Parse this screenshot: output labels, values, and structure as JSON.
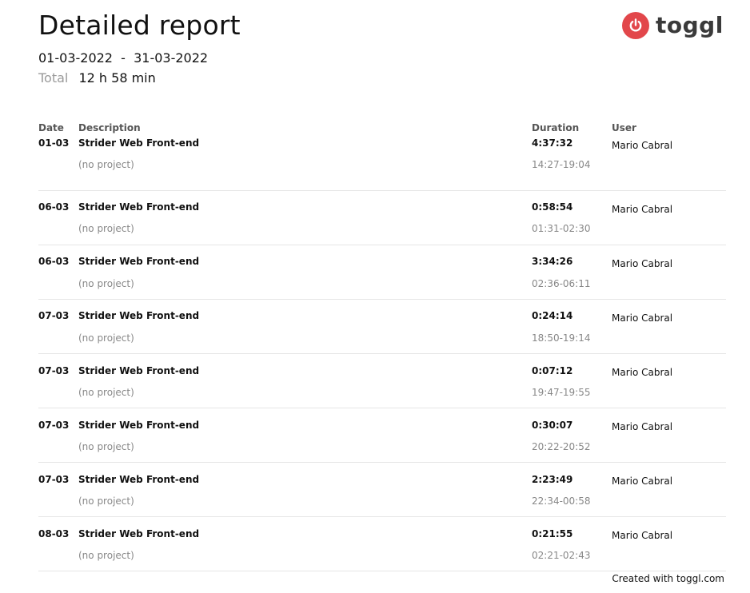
{
  "report": {
    "title": "Detailed report",
    "date_range": "01-03-2022  -  31-03-2022",
    "total_label": "Total",
    "total_value": "12 h 58 min"
  },
  "logo": {
    "wordmark": "toggl",
    "icon": "power-icon",
    "color": "#e2474b"
  },
  "table": {
    "headers": {
      "date": "Date",
      "description": "Description",
      "duration": "Duration",
      "user": "User"
    },
    "rows": [
      {
        "date": "01-03",
        "description": "Strider Web Front-end",
        "project": "(no project)",
        "duration": "4:37:32",
        "time_range": "14:27-19:04",
        "user": "Mario Cabral"
      },
      {
        "date": "06-03",
        "description": "Strider Web Front-end",
        "project": "(no project)",
        "duration": "0:58:54",
        "time_range": "01:31-02:30",
        "user": "Mario Cabral"
      },
      {
        "date": "06-03",
        "description": "Strider Web Front-end",
        "project": "(no project)",
        "duration": "3:34:26",
        "time_range": "02:36-06:11",
        "user": "Mario Cabral"
      },
      {
        "date": "07-03",
        "description": "Strider Web Front-end",
        "project": "(no project)",
        "duration": "0:24:14",
        "time_range": "18:50-19:14",
        "user": "Mario Cabral"
      },
      {
        "date": "07-03",
        "description": "Strider Web Front-end",
        "project": "(no project)",
        "duration": "0:07:12",
        "time_range": "19:47-19:55",
        "user": "Mario Cabral"
      },
      {
        "date": "07-03",
        "description": "Strider Web Front-end",
        "project": "(no project)",
        "duration": "0:30:07",
        "time_range": "20:22-20:52",
        "user": "Mario Cabral"
      },
      {
        "date": "07-03",
        "description": "Strider Web Front-end",
        "project": "(no project)",
        "duration": "2:23:49",
        "time_range": "22:34-00:58",
        "user": "Mario Cabral"
      },
      {
        "date": "08-03",
        "description": "Strider Web Front-end",
        "project": "(no project)",
        "duration": "0:21:55",
        "time_range": "02:21-02:43",
        "user": "Mario Cabral"
      }
    ]
  },
  "footer": {
    "text": "Created with toggl.com"
  }
}
